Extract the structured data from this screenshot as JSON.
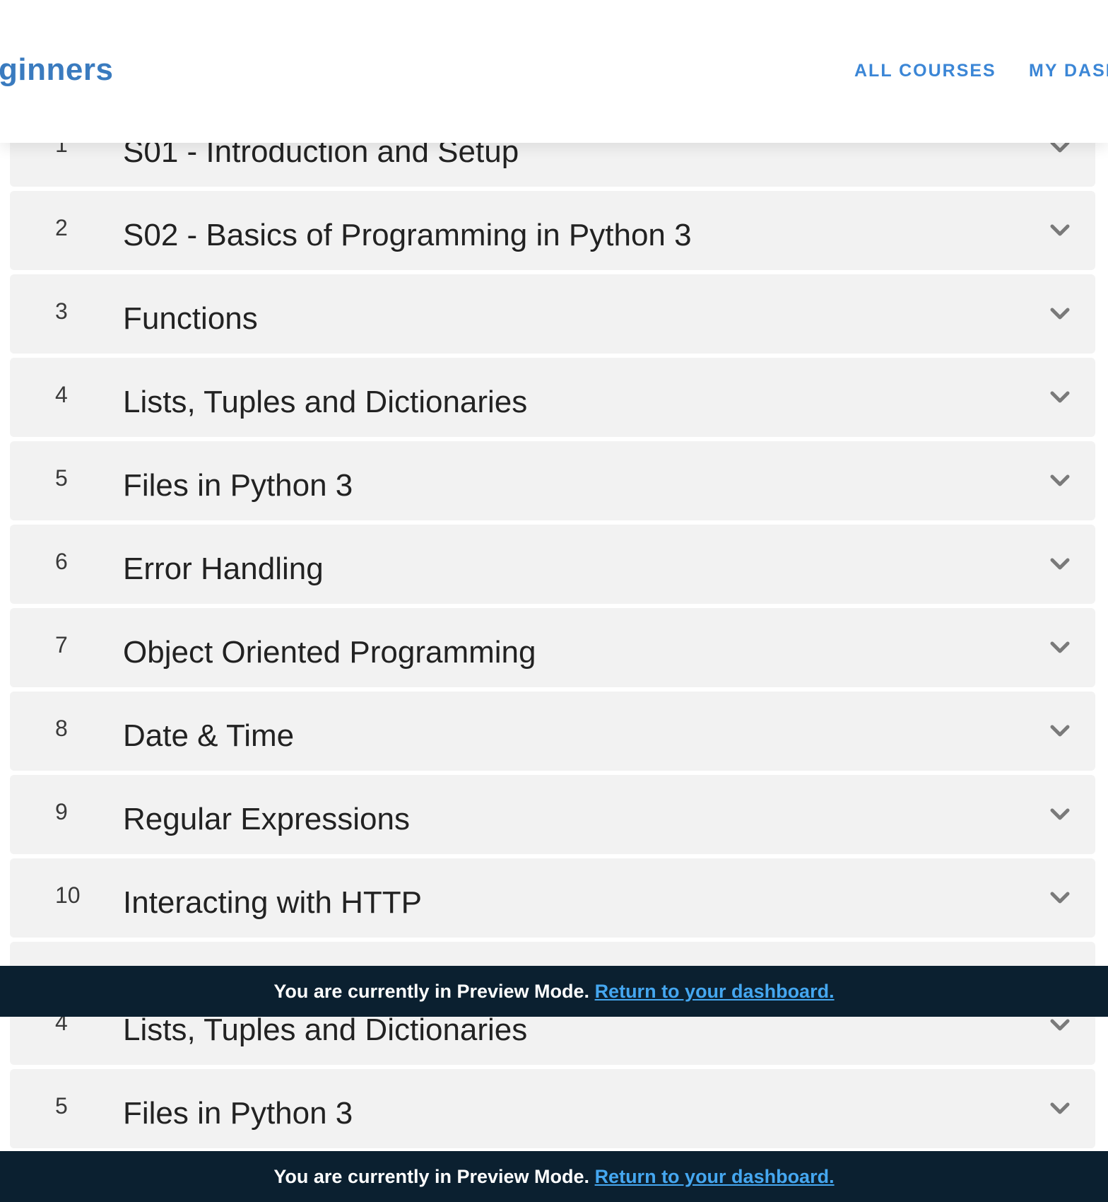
{
  "header": {
    "brand": "ginners",
    "nav": {
      "all_courses": "ALL COURSES",
      "my_dashboard": "MY DASH"
    }
  },
  "curriculum": {
    "sections": [
      {
        "num": "1",
        "title": "S01 - Introduction and Setup"
      },
      {
        "num": "2",
        "title": "S02 - Basics of Programming in Python 3"
      },
      {
        "num": "3",
        "title": "Functions"
      },
      {
        "num": "4",
        "title": "Lists, Tuples and Dictionaries"
      },
      {
        "num": "5",
        "title": "Files in Python 3"
      },
      {
        "num": "6",
        "title": "Error Handling"
      },
      {
        "num": "7",
        "title": "Object Oriented Programming"
      },
      {
        "num": "8",
        "title": "Date & Time"
      },
      {
        "num": "9",
        "title": "Regular Expressions"
      },
      {
        "num": "10",
        "title": "Interacting with HTTP"
      }
    ],
    "lower_sections": [
      {
        "num": "4",
        "title": "Lists, Tuples and Dictionaries"
      },
      {
        "num": "5",
        "title": "Files in Python 3"
      }
    ]
  },
  "preview_banner": {
    "message": "You are currently in Preview Mode.",
    "link_text": "Return to your dashboard."
  },
  "icons": {
    "chevron": "chevron-down-icon"
  },
  "colors": {
    "brand": "#3a7bbf",
    "nav_link": "#3b86d6",
    "banner_bg": "#0b2030",
    "banner_link": "#45a7f0",
    "row_bg": "#f2f2f2"
  }
}
